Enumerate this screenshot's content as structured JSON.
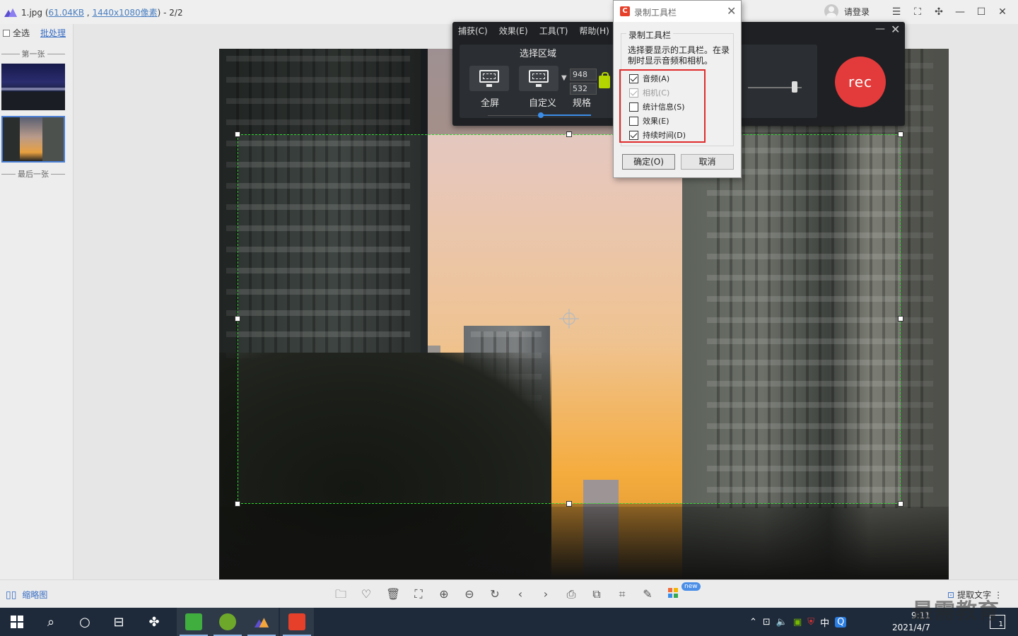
{
  "viewer": {
    "title_prefix": "1.jpg (",
    "file_size": "61.04KB",
    "title_sep": " , ",
    "resolution": "1440x1080像素",
    "title_suffix": ") - 2/2",
    "login_label": "请登录",
    "select_all_label": "全选",
    "batch_label": "批处理",
    "first_label": "第一张",
    "last_label": "最后一张",
    "thumbs_toggle_label": "缩略图",
    "extract_text_label": "提取文字",
    "new_badge": "new"
  },
  "recorder": {
    "menu": [
      "捕获(C)",
      "效果(E)",
      "工具(T)",
      "帮助(H)"
    ],
    "region_title": "选择区域",
    "fullscreen_label": "全屏",
    "custom_label": "自定义",
    "spec_label": "规格",
    "width_value": "948",
    "height_value": "532",
    "rec_label": "rec"
  },
  "dialog": {
    "title": "录制工具栏",
    "group_label": "录制工具栏",
    "description": "选择要显示的工具栏。在录制时显示音频和相机。",
    "options": [
      {
        "label": "音频(A)",
        "checked": true,
        "disabled": false
      },
      {
        "label": "相机(C)",
        "checked": true,
        "disabled": true
      },
      {
        "label": "统计信息(S)",
        "checked": false,
        "disabled": false
      },
      {
        "label": "效果(E)",
        "checked": false,
        "disabled": false
      },
      {
        "label": "持续时间(D)",
        "checked": true,
        "disabled": false
      }
    ],
    "ok_label": "确定(O)",
    "cancel_label": "取消"
  },
  "taskbar": {
    "clock_time": "9:11",
    "clock_date": "2021/4/7",
    "ime_label": "中",
    "notification_count": "1"
  },
  "watermark": "最需教育",
  "colors": {
    "selection": "#2fd62f",
    "rec_button": "#e33b3b",
    "highlight_frame": "#e02b2b",
    "link": "#3a6fc4"
  }
}
